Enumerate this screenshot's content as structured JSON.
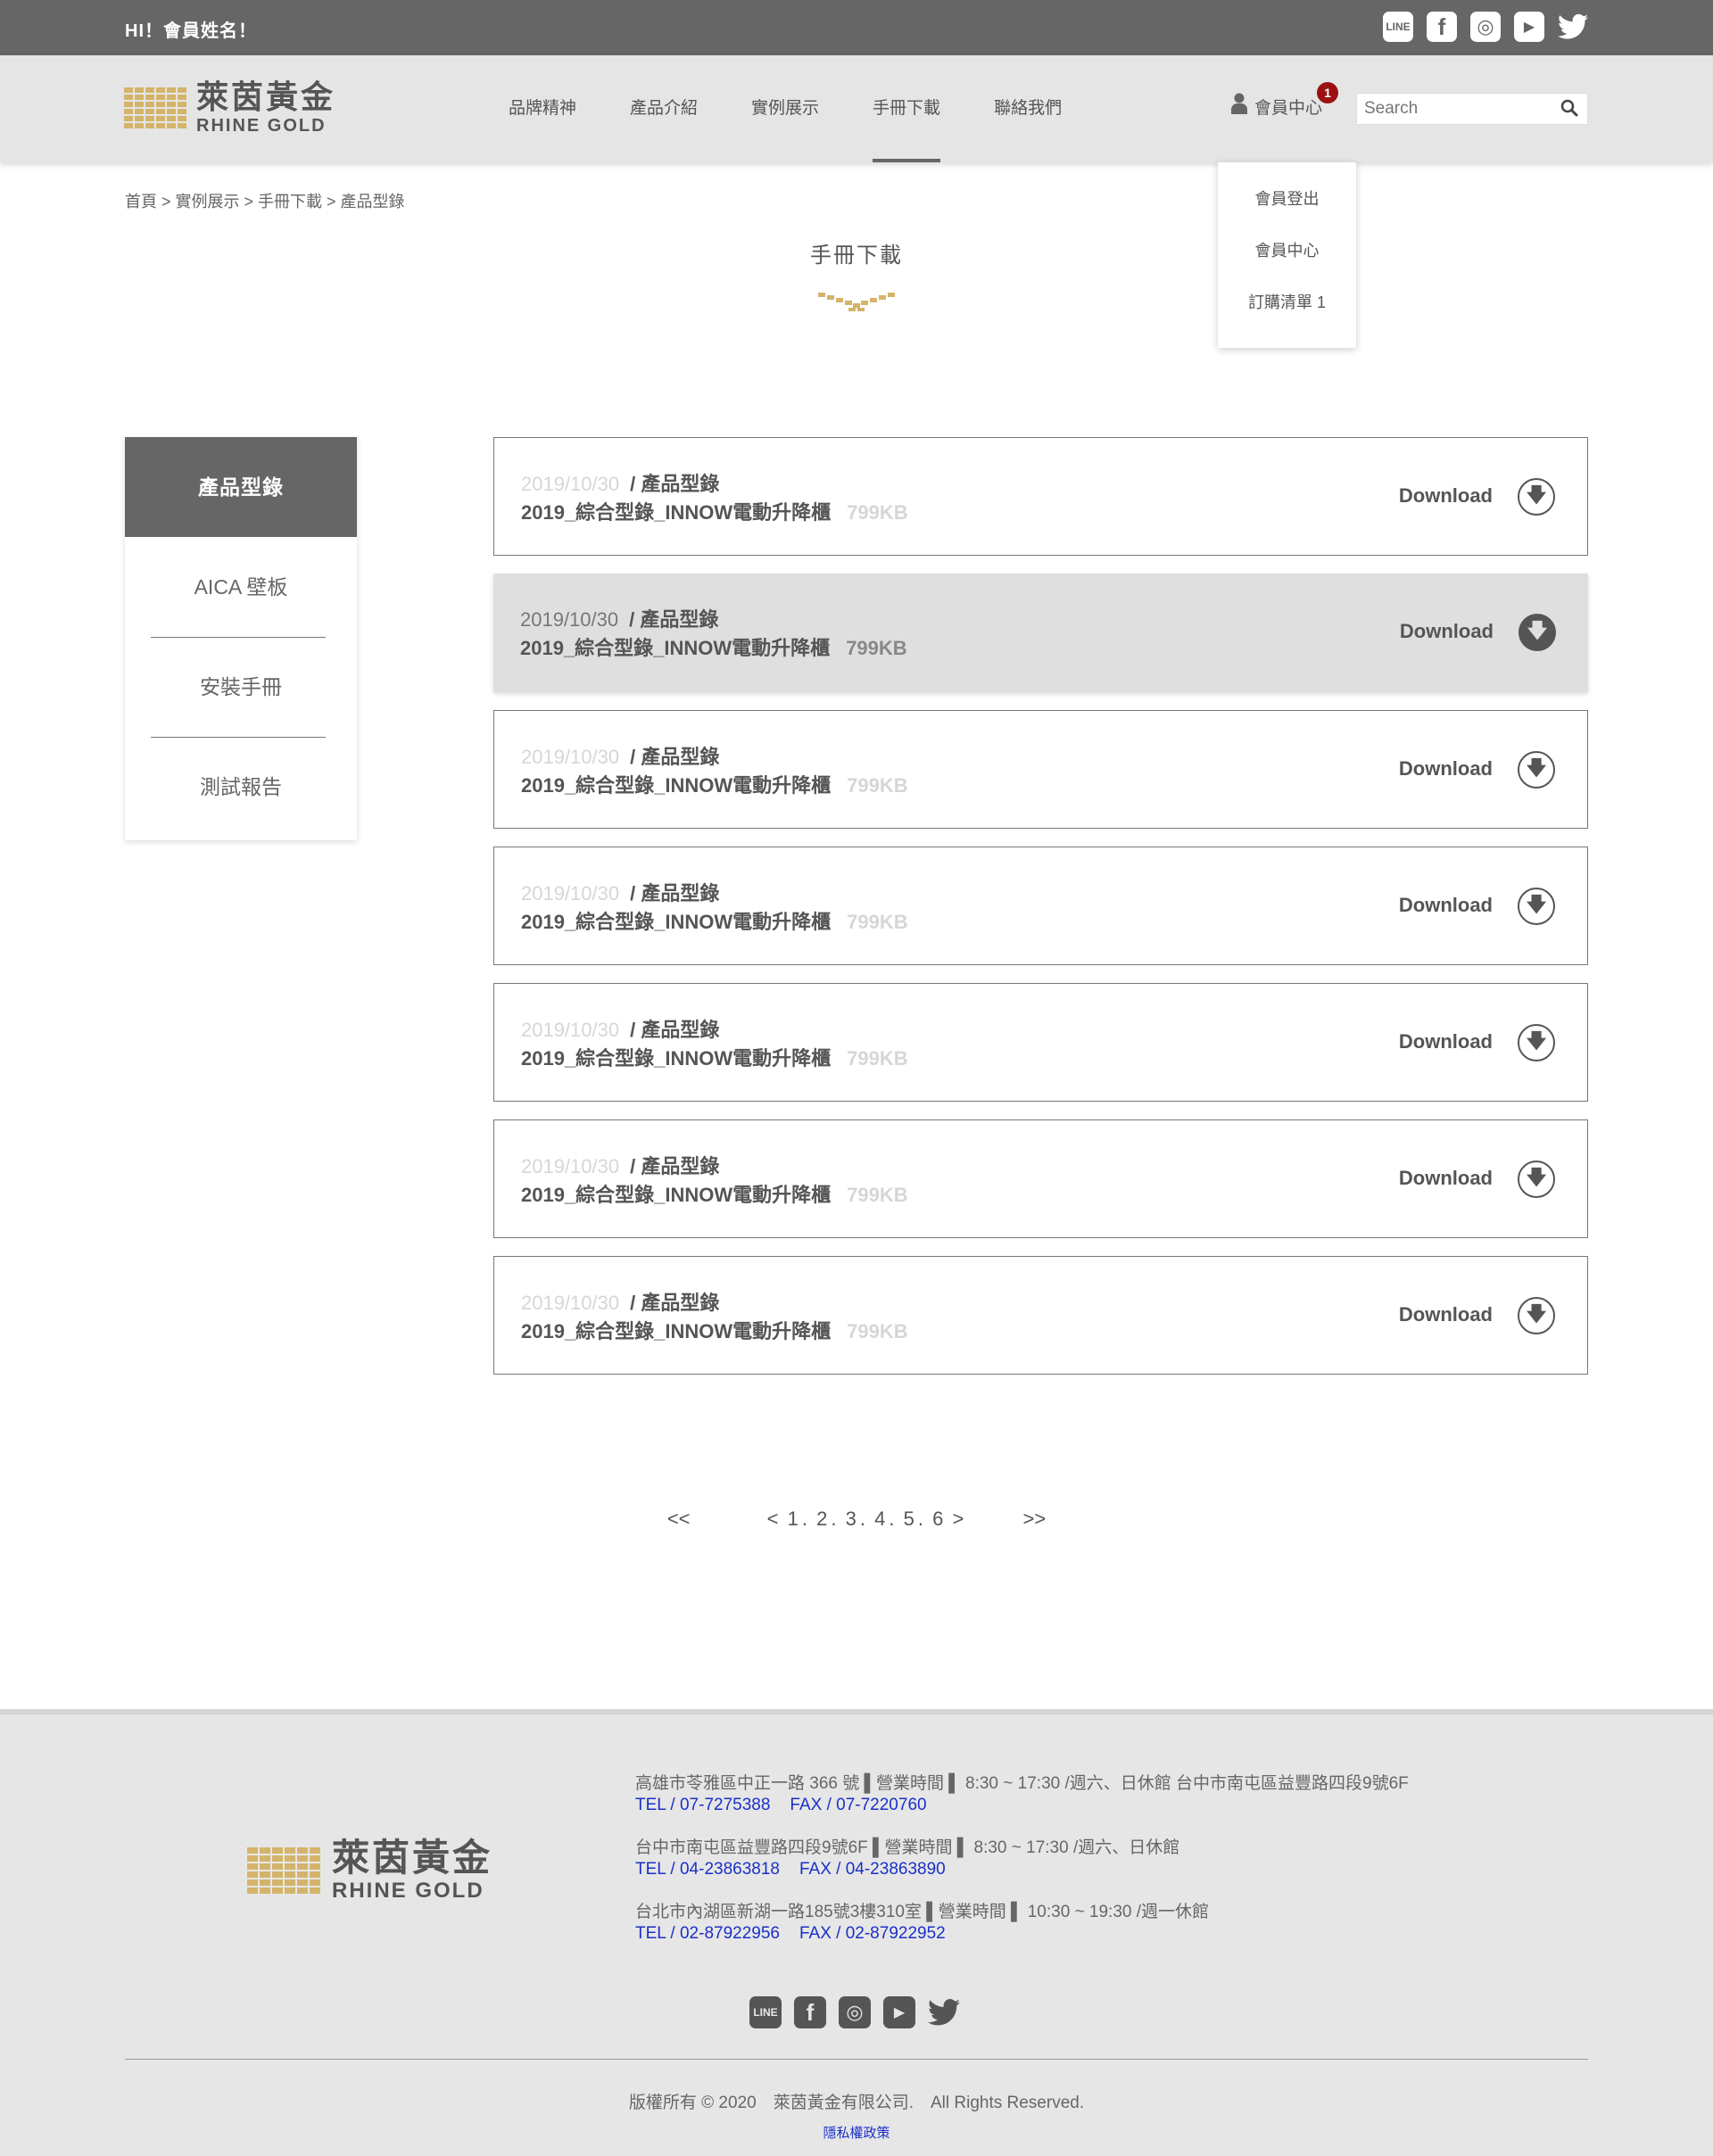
{
  "topbar": {
    "greeting": "HI！會員姓名！",
    "social": [
      {
        "icon": "line-icon",
        "label": "LINE"
      },
      {
        "icon": "facebook-icon",
        "label": "f"
      },
      {
        "icon": "instagram-icon",
        "label": "◎"
      },
      {
        "icon": "youtube-icon",
        "label": "▶"
      },
      {
        "icon": "twitter-icon",
        "label": "🐦"
      }
    ]
  },
  "logo": {
    "cn": "萊茵黃金",
    "en": "RHINE GOLD",
    "color": "#d4b46a"
  },
  "nav": {
    "items": [
      {
        "label": "品牌精神"
      },
      {
        "label": "產品介紹"
      },
      {
        "label": "實例展示"
      },
      {
        "label": "手冊下載",
        "active": true
      },
      {
        "label": "聯絡我們"
      }
    ]
  },
  "member": {
    "label": "會員中心",
    "badge": "1"
  },
  "search": {
    "placeholder": "Search"
  },
  "dropdown": {
    "items": [
      "會員登出",
      "會員中心",
      "訂購清單 1"
    ]
  },
  "breadcrumb": "首頁 > 實例展示 > 手冊下載 > 產品型錄",
  "page_title": "手冊下載",
  "sidebar": {
    "active": "產品型錄",
    "items": [
      "AICA 壁板",
      "安裝手冊",
      "測試報告"
    ]
  },
  "downloads": {
    "button_label": "Download",
    "rows": [
      {
        "date": "2019/10/30",
        "category": "/ 產品型錄",
        "name": "2019_綜合型錄_INNOW電動升降櫃",
        "size": "799KB"
      },
      {
        "date": "2019/10/30",
        "category": "/ 產品型錄",
        "name": "2019_綜合型錄_INNOW電動升降櫃",
        "size": "799KB",
        "hover": true
      },
      {
        "date": "2019/10/30",
        "category": "/ 產品型錄",
        "name": "2019_綜合型錄_INNOW電動升降櫃",
        "size": "799KB"
      },
      {
        "date": "2019/10/30",
        "category": "/ 產品型錄",
        "name": "2019_綜合型錄_INNOW電動升降櫃",
        "size": "799KB"
      },
      {
        "date": "2019/10/30",
        "category": "/ 產品型錄",
        "name": "2019_綜合型錄_INNOW電動升降櫃",
        "size": "799KB"
      },
      {
        "date": "2019/10/30",
        "category": "/ 產品型錄",
        "name": "2019_綜合型錄_INNOW電動升降櫃",
        "size": "799KB"
      },
      {
        "date": "2019/10/30",
        "category": "/ 產品型錄",
        "name": "2019_綜合型錄_INNOW電動升降櫃",
        "size": "799KB"
      }
    ]
  },
  "pagination": {
    "first": "<<",
    "prev": "<",
    "pages": [
      "1",
      ".",
      "2",
      ".",
      "3",
      ".",
      "4",
      ".",
      "5",
      ".",
      "6"
    ],
    "next": ">",
    "last": ">>"
  },
  "footer": {
    "addresses": [
      {
        "line": "高雄市苓雅區中正一路 366 號 ▌營業時間 ▌ 8:30 ~ 17:30 /週六、日休館 台中市南屯區益豐路四段9號6F",
        "tel": "TEL / 07-7275388",
        "fax": "FAX / 07-7220760"
      },
      {
        "line": "台中市南屯區益豐路四段9號6F ▌營業時間 ▌ 8:30 ~ 17:30 /週六、日休館",
        "tel": "TEL / 04-23863818",
        "fax": "FAX / 04-23863890"
      },
      {
        "line": "台北市內湖區新湖一路185號3樓310室 ▌營業時間 ▌ 10:30 ~ 19:30 /週一休館",
        "tel": "TEL / 02-87922956",
        "fax": "FAX / 02-87922952"
      }
    ],
    "copyright": "版權所有 © 2020　萊茵黃金有限公司.　All Rights Reserved.",
    "privacy": "隱私權政策",
    "link_color": "#1a30c9"
  }
}
